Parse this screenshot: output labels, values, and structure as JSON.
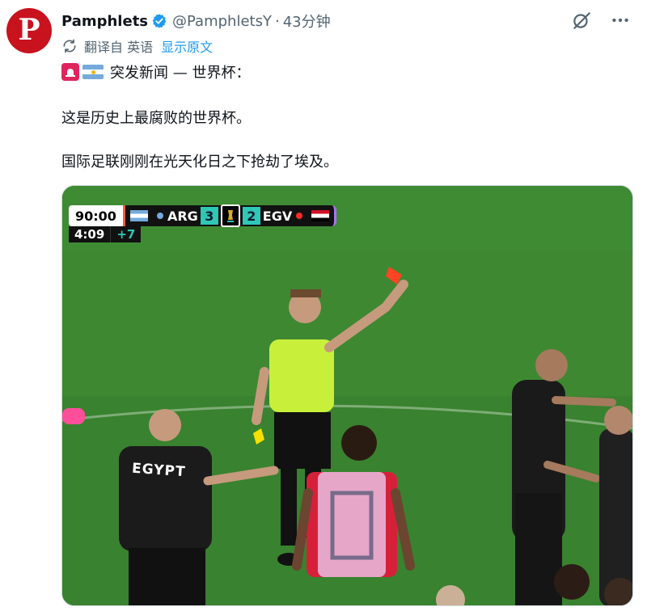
{
  "author": {
    "avatar_letter": "P",
    "display_name": "Pamphlets",
    "handle": "@PamphletsY",
    "separator": "·",
    "time": "43分钟"
  },
  "translation": {
    "translated_from": "翻译自 英语",
    "show_original": "显示原文"
  },
  "tweet": {
    "line1": "突发新闻 — 世界杯：",
    "line2": "这是历史上最腐败的世界杯。",
    "line3": "国际足联刚刚在光天化日之下抢劫了埃及。"
  },
  "media": {
    "scoreboard": {
      "clock": "90:00",
      "home": "ARG",
      "home_score": "3",
      "away_score": "2",
      "away": "EGV",
      "stoppage_time": "4:09",
      "added_time": "+7"
    },
    "jersey_text": "EGYPT"
  },
  "colors": {
    "accent": "#1d9bf0",
    "text": "#0f1419",
    "muted": "#536471",
    "avatar_bg": "#c8121e",
    "verified": "#1d9bf0",
    "pitch": "#3f8a33",
    "score_teal": "#2fc7b5"
  },
  "icons": {
    "verified": "verified-badge-icon",
    "grok": "grok-icon",
    "more": "more-icon",
    "translate": "translate-icon",
    "siren": "siren-emoji-icon",
    "flag": "argentina-flag-icon"
  }
}
